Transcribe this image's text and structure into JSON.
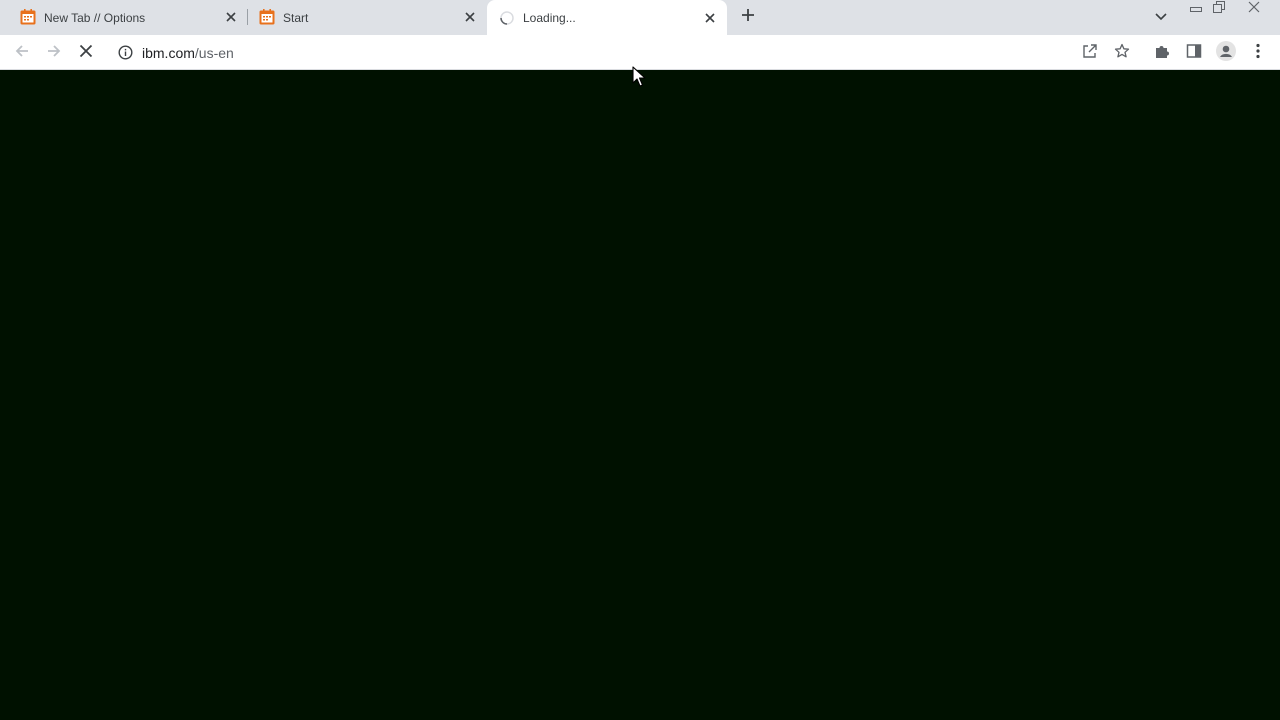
{
  "browser": {
    "tabs": [
      {
        "title": "New Tab // Options",
        "favicon": "calendar-app-icon",
        "active": false
      },
      {
        "title": "Start",
        "favicon": "calendar-app-icon",
        "active": false
      },
      {
        "title": "Loading...",
        "favicon": "loading-spinner-icon",
        "active": true
      }
    ],
    "omnibox": {
      "host": "ibm.com",
      "path": "/us-en"
    },
    "colors": {
      "tabstrip_bg": "#dee1e6",
      "page_bg": "#001100",
      "favicon_orange": "#e8711c"
    }
  },
  "icons": {
    "back": "back-arrow-icon",
    "forward": "forward-arrow-icon",
    "stop": "stop-loading-icon",
    "site_info": "info-icon",
    "share": "share-icon",
    "bookmark": "star-icon",
    "extensions": "puzzle-icon",
    "side_panel": "side-panel-icon",
    "profile": "profile-icon",
    "menu": "kebab-menu-icon"
  }
}
